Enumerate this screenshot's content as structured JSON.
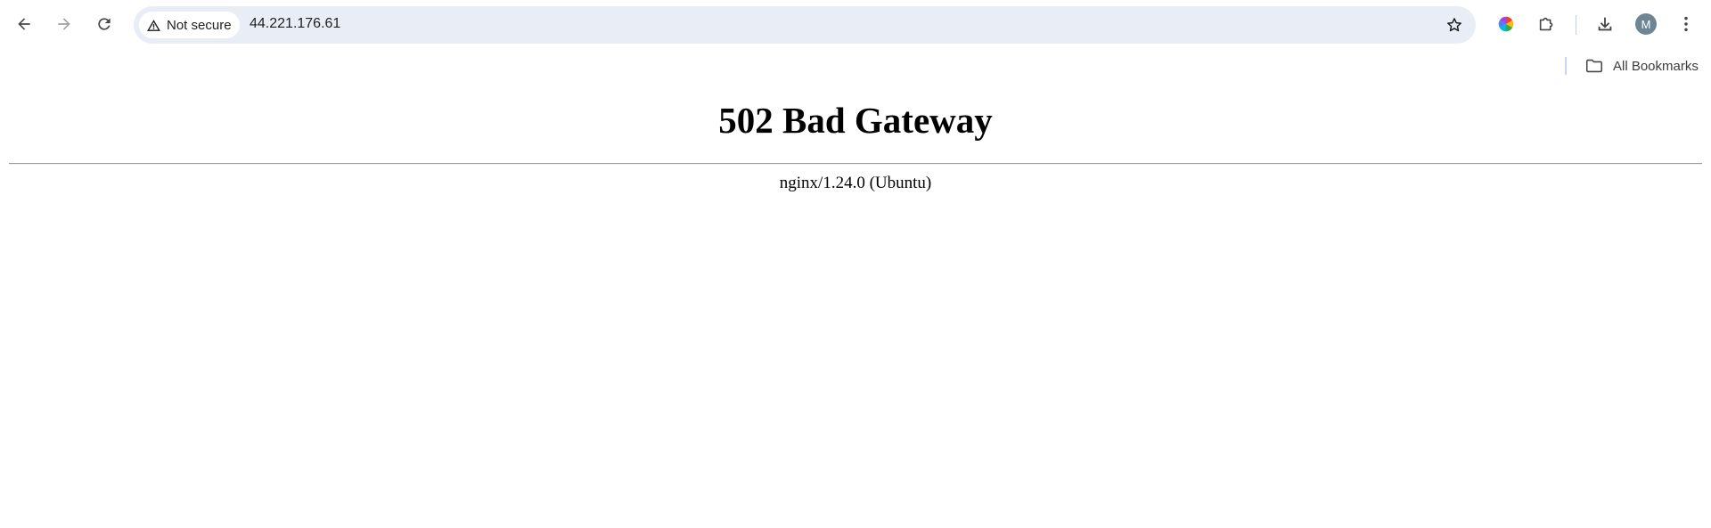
{
  "browser": {
    "security_label": "Not secure",
    "url": "44.221.176.61",
    "profile_initial": "M",
    "icons": {
      "back": "arrow-left-icon",
      "forward": "arrow-right-icon",
      "reload": "reload-icon",
      "security": "warning-triangle-icon",
      "bookmark": "star-icon",
      "extension_color": "color-wheel-icon",
      "extensions": "puzzle-icon",
      "downloads": "download-icon",
      "menu": "kebab-menu-icon"
    }
  },
  "bookmarks_bar": {
    "all_bookmarks_label": "All Bookmarks",
    "icon": "folder-icon"
  },
  "page": {
    "title": "502 Bad Gateway",
    "server": "nginx/1.24.0 (Ubuntu)"
  },
  "colors": {
    "omnibox_bg": "#e9eef6",
    "avatar_bg": "#6e8595"
  }
}
